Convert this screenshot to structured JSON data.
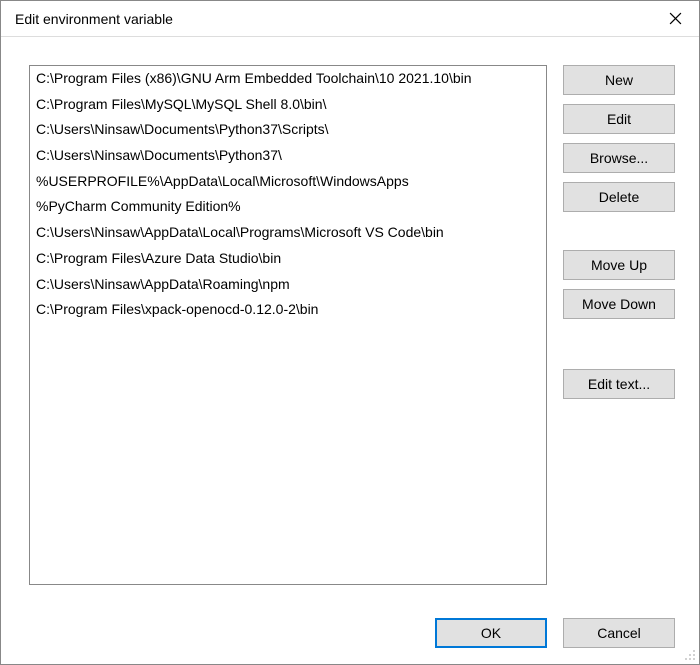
{
  "window": {
    "title": "Edit environment variable"
  },
  "entries": [
    "C:\\Program Files (x86)\\GNU Arm Embedded Toolchain\\10 2021.10\\bin",
    "C:\\Program Files\\MySQL\\MySQL Shell 8.0\\bin\\",
    "C:\\Users\\Ninsaw\\Documents\\Python37\\Scripts\\",
    "C:\\Users\\Ninsaw\\Documents\\Python37\\",
    "%USERPROFILE%\\AppData\\Local\\Microsoft\\WindowsApps",
    "%PyCharm Community Edition%",
    "C:\\Users\\Ninsaw\\AppData\\Local\\Programs\\Microsoft VS Code\\bin",
    "C:\\Program Files\\Azure Data Studio\\bin",
    "C:\\Users\\Ninsaw\\AppData\\Roaming\\npm",
    "C:\\Program Files\\xpack-openocd-0.12.0-2\\bin"
  ],
  "buttons": {
    "new": "New",
    "edit": "Edit",
    "browse": "Browse...",
    "delete": "Delete",
    "move_up": "Move Up",
    "move_down": "Move Down",
    "edit_text": "Edit text...",
    "ok": "OK",
    "cancel": "Cancel"
  }
}
